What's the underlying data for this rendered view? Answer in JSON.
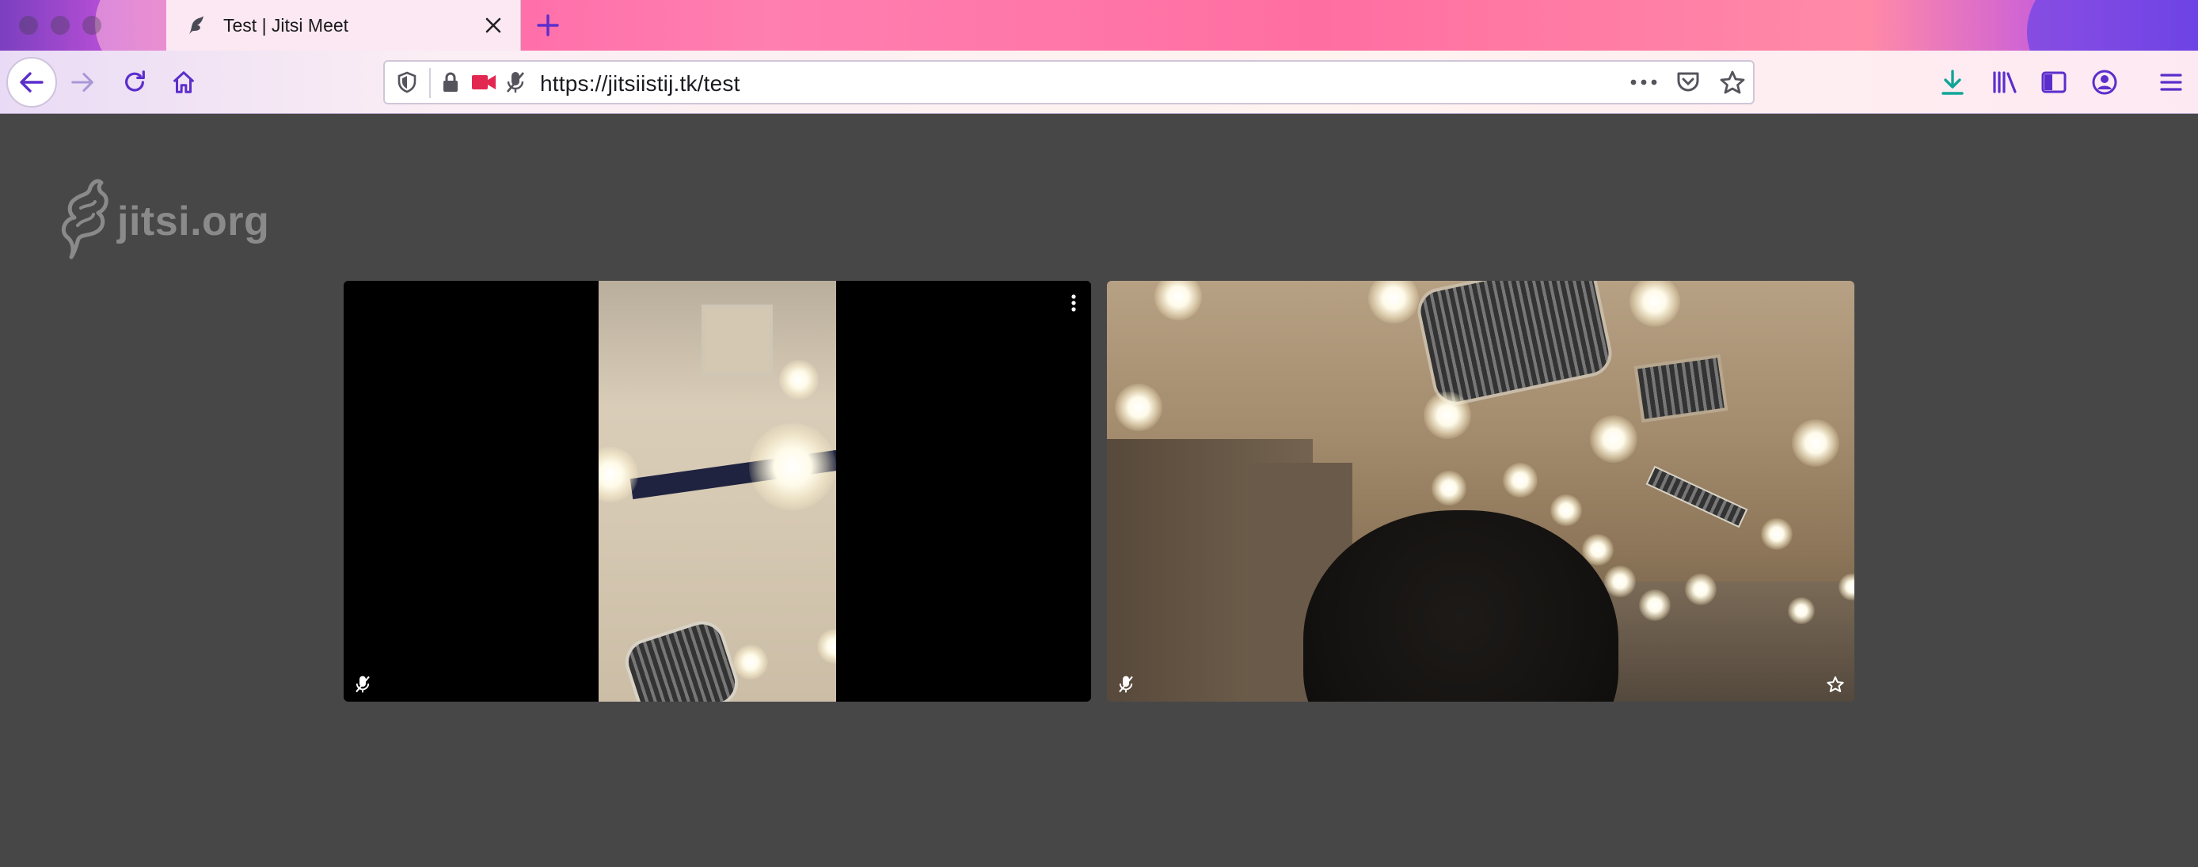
{
  "browser": {
    "tab_title": "Test | Jitsi Meet",
    "url": "https://jitsiistij.tk/test"
  },
  "page": {
    "watermark_text": "jitsi.org"
  },
  "icons": {
    "tab_favicon": "jitsi-favicon-icon",
    "tab_close": "close-icon",
    "new_tab": "plus-icon",
    "back": "arrow-left-icon",
    "forward": "arrow-right-icon",
    "reload": "reload-icon",
    "home": "home-icon",
    "tracking": "shield-icon",
    "lock": "lock-icon",
    "camera": "camera-icon",
    "mic_blocked": "mic-off-icon",
    "page_actions": "more-horizontal-icon",
    "pocket": "pocket-icon",
    "bookmark": "star-icon",
    "downloads": "download-icon",
    "library": "library-icon",
    "sidebar": "sidebar-icon",
    "account": "account-icon",
    "menu": "hamburger-menu-icon",
    "tile_more": "more-vertical-icon",
    "tile_muted": "mic-off-icon",
    "tile_moderator": "star-outline-icon"
  },
  "colors": {
    "page_background": "#474747",
    "accent": "#5b2ecc",
    "camera_active": "#e22850",
    "download": "#12a597"
  }
}
